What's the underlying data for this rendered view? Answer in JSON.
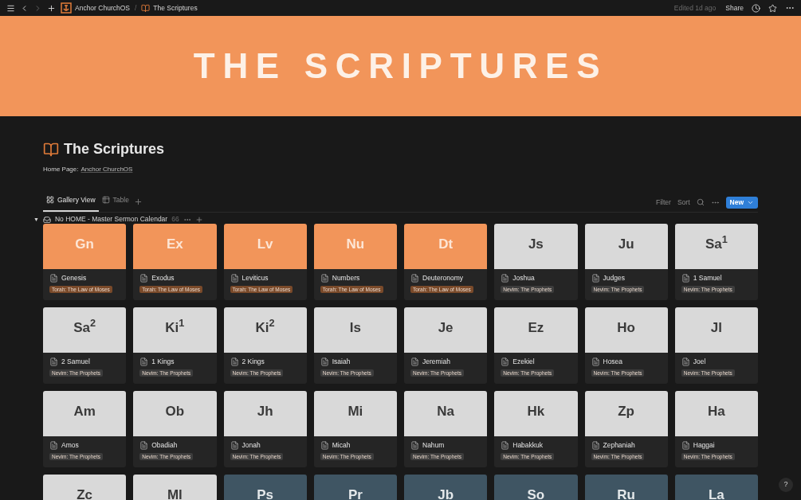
{
  "topbar": {
    "breadcrumbs": [
      {
        "label": "Anchor ChurchOS"
      },
      {
        "label": "The Scriptures"
      }
    ],
    "separator": "/",
    "edited": "Edited 1d ago",
    "share": "Share"
  },
  "banner": {
    "text": "THE SCRIPTURES"
  },
  "page": {
    "title": "The Scriptures",
    "home_label": "Home Page:",
    "home_link": "Anchor ChurchOS"
  },
  "views": [
    {
      "label": "Gallery View",
      "kind": "gallery",
      "selected": true
    },
    {
      "label": "Table",
      "kind": "table",
      "selected": false
    }
  ],
  "toolbar": {
    "filter": "Filter",
    "sort": "Sort",
    "new": "New"
  },
  "group": {
    "title": "No HOME - Master Sermon Calendar",
    "count": "66",
    "toggle": "▼",
    "expanded": true
  },
  "cards": [
    {
      "cover": "Gn",
      "color": "#f2955a",
      "title": "Genesis",
      "tag": "Torah: The Law of Moses",
      "kind": "torah"
    },
    {
      "cover": "Ex",
      "color": "#f2955a",
      "title": "Exodus",
      "tag": "Torah: The Law of Moses",
      "kind": "torah"
    },
    {
      "cover": "Lv",
      "color": "#f2955a",
      "title": "Leviticus",
      "tag": "Torah: The Law of Moses",
      "kind": "torah"
    },
    {
      "cover": "Nu",
      "color": "#f2955a",
      "title": "Numbers",
      "tag": "Torah: The Law of Moses",
      "kind": "torah"
    },
    {
      "cover": "Dt",
      "color": "#f2955a",
      "title": "Deuteronomy",
      "tag": "Torah: The Law of Moses",
      "kind": "torah"
    },
    {
      "cover": "Js",
      "color": "#d9d9d9",
      "title": "Joshua",
      "tag": "Nevim: The Prophets",
      "kind": "prophets"
    },
    {
      "cover": "Ju",
      "color": "#d9d9d9",
      "title": "Judges",
      "tag": "Nevim: The Prophets",
      "kind": "prophets"
    },
    {
      "cover": "Sa$^{1}$",
      "color": "#d9d9d9",
      "title": "1 Samuel",
      "tag": "Nevim: The Prophets",
      "kind": "prophets"
    },
    {
      "cover": "Sa$^{2}$",
      "color": "#d9d9d9",
      "title": "2 Samuel",
      "tag": "Nevim: The Prophets",
      "kind": "prophets"
    },
    {
      "cover": "Ki$^{1}$",
      "color": "#d9d9d9",
      "title": "1 Kings",
      "tag": "Nevim: The Prophets",
      "kind": "prophets"
    },
    {
      "cover": "Ki$^{2}$",
      "color": "#d9d9d9",
      "title": "2 Kings",
      "tag": "Nevim: The Prophets",
      "kind": "prophets"
    },
    {
      "cover": "Is",
      "color": "#d9d9d9",
      "title": "Isaiah",
      "tag": "Nevim: The Prophets",
      "kind": "prophets"
    },
    {
      "cover": "Je",
      "color": "#d9d9d9",
      "title": "Jeremiah",
      "tag": "Nevim: The Prophets",
      "kind": "prophets"
    },
    {
      "cover": "Ez",
      "color": "#d9d9d9",
      "title": "Ezekiel",
      "tag": "Nevim: The Prophets",
      "kind": "prophets"
    },
    {
      "cover": "Ho",
      "color": "#d9d9d9",
      "title": "Hosea",
      "tag": "Nevim: The Prophets",
      "kind": "prophets"
    },
    {
      "cover": "Jl",
      "color": "#d9d9d9",
      "title": "Joel",
      "tag": "Nevim: The Prophets",
      "kind": "prophets"
    },
    {
      "cover": "Am",
      "color": "#d9d9d9",
      "title": "Amos",
      "tag": "Nevim: The Prophets",
      "kind": "prophets"
    },
    {
      "cover": "Ob",
      "color": "#d9d9d9",
      "title": "Obadiah",
      "tag": "Nevim: The Prophets",
      "kind": "prophets"
    },
    {
      "cover": "Jh",
      "color": "#d9d9d9",
      "title": "Jonah",
      "tag": "Nevim: The Prophets",
      "kind": "prophets"
    },
    {
      "cover": "Mi",
      "color": "#d9d9d9",
      "title": "Micah",
      "tag": "Nevim: The Prophets",
      "kind": "prophets"
    },
    {
      "cover": "Na",
      "color": "#d9d9d9",
      "title": "Nahum",
      "tag": "Nevim: The Prophets",
      "kind": "prophets"
    },
    {
      "cover": "Hk",
      "color": "#d9d9d9",
      "title": "Habakkuk",
      "tag": "Nevim: The Prophets",
      "kind": "prophets"
    },
    {
      "cover": "Zp",
      "color": "#d9d9d9",
      "title": "Zephaniah",
      "tag": "Nevim: The Prophets",
      "kind": "prophets"
    },
    {
      "cover": "Ha",
      "color": "#d9d9d9",
      "title": "Haggai",
      "tag": "Nevim: The Prophets",
      "kind": "prophets"
    },
    {
      "cover": "Zc",
      "color": "#d9d9d9"
    },
    {
      "cover": "Ml",
      "color": "#d9d9d9"
    },
    {
      "cover": "Ps",
      "color": "#3f5563"
    },
    {
      "cover": "Pr",
      "color": "#3f5563"
    },
    {
      "cover": "Jb",
      "color": "#3f5563"
    },
    {
      "cover": "So",
      "color": "#3f5563"
    },
    {
      "cover": "Ru",
      "color": "#3f5563"
    },
    {
      "cover": "La",
      "color": "#3f5563"
    }
  ],
  "help": "?"
}
